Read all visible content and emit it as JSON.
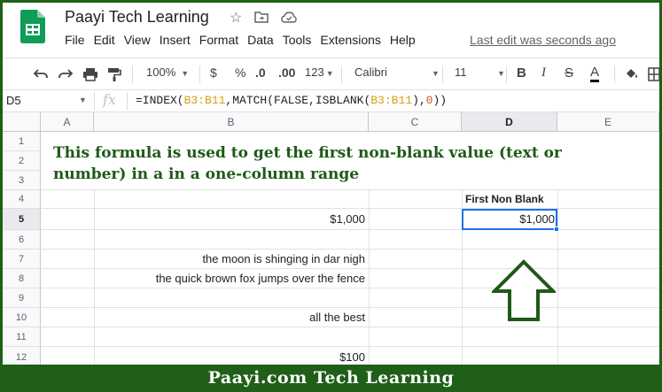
{
  "window": {
    "title": "Paayi Tech Learning",
    "last_edit": "Last edit was seconds ago",
    "icons": [
      "star-icon",
      "move-to-folder-icon",
      "cloud-status-icon"
    ]
  },
  "menu": [
    "File",
    "Edit",
    "View",
    "Insert",
    "Format",
    "Data",
    "Tools",
    "Extensions",
    "Help"
  ],
  "toolbar": {
    "zoom": "100%",
    "currency": "$",
    "percent": "%",
    "decrease_decimal": ".0",
    "increase_decimal": ".00",
    "number_format": "123",
    "font": "Calibri",
    "font_size": "11",
    "bold": "B",
    "italic": "I",
    "strikethrough": "S",
    "text_color": "A"
  },
  "formula_bar": {
    "cell_ref": "D5",
    "fx": "fx",
    "formula_parts": [
      "=INDEX(",
      "B3:B11",
      ",MATCH(FALSE,ISBLANK(",
      "B3:B11",
      "),",
      "0",
      "))"
    ]
  },
  "grid": {
    "columns": [
      "A",
      "B",
      "C",
      "D",
      "E"
    ],
    "rows": [
      "1",
      "2",
      "3",
      "4",
      "5",
      "6",
      "7",
      "8",
      "9",
      "10",
      "11",
      "12"
    ],
    "selected_column": "D",
    "selected_row": "5",
    "heading": "This formula is used to get the first non-blank value (text or number) in a in a one-column range",
    "d4_label": "First Non Blank",
    "d5_value": "$1,000",
    "b_values": {
      "b5": "$1,000",
      "b7": "the moon is shinging in dar nigh",
      "b8": "the quick brown fox jumps over the fence",
      "b10": "all the best",
      "b12": "$100"
    }
  },
  "footer": {
    "text": "Paayi.com Tech Learning"
  },
  "colors": {
    "brand_green": "#1f5f17",
    "heading_green": "#1e5a16",
    "selection_blue": "#1a73e8"
  }
}
